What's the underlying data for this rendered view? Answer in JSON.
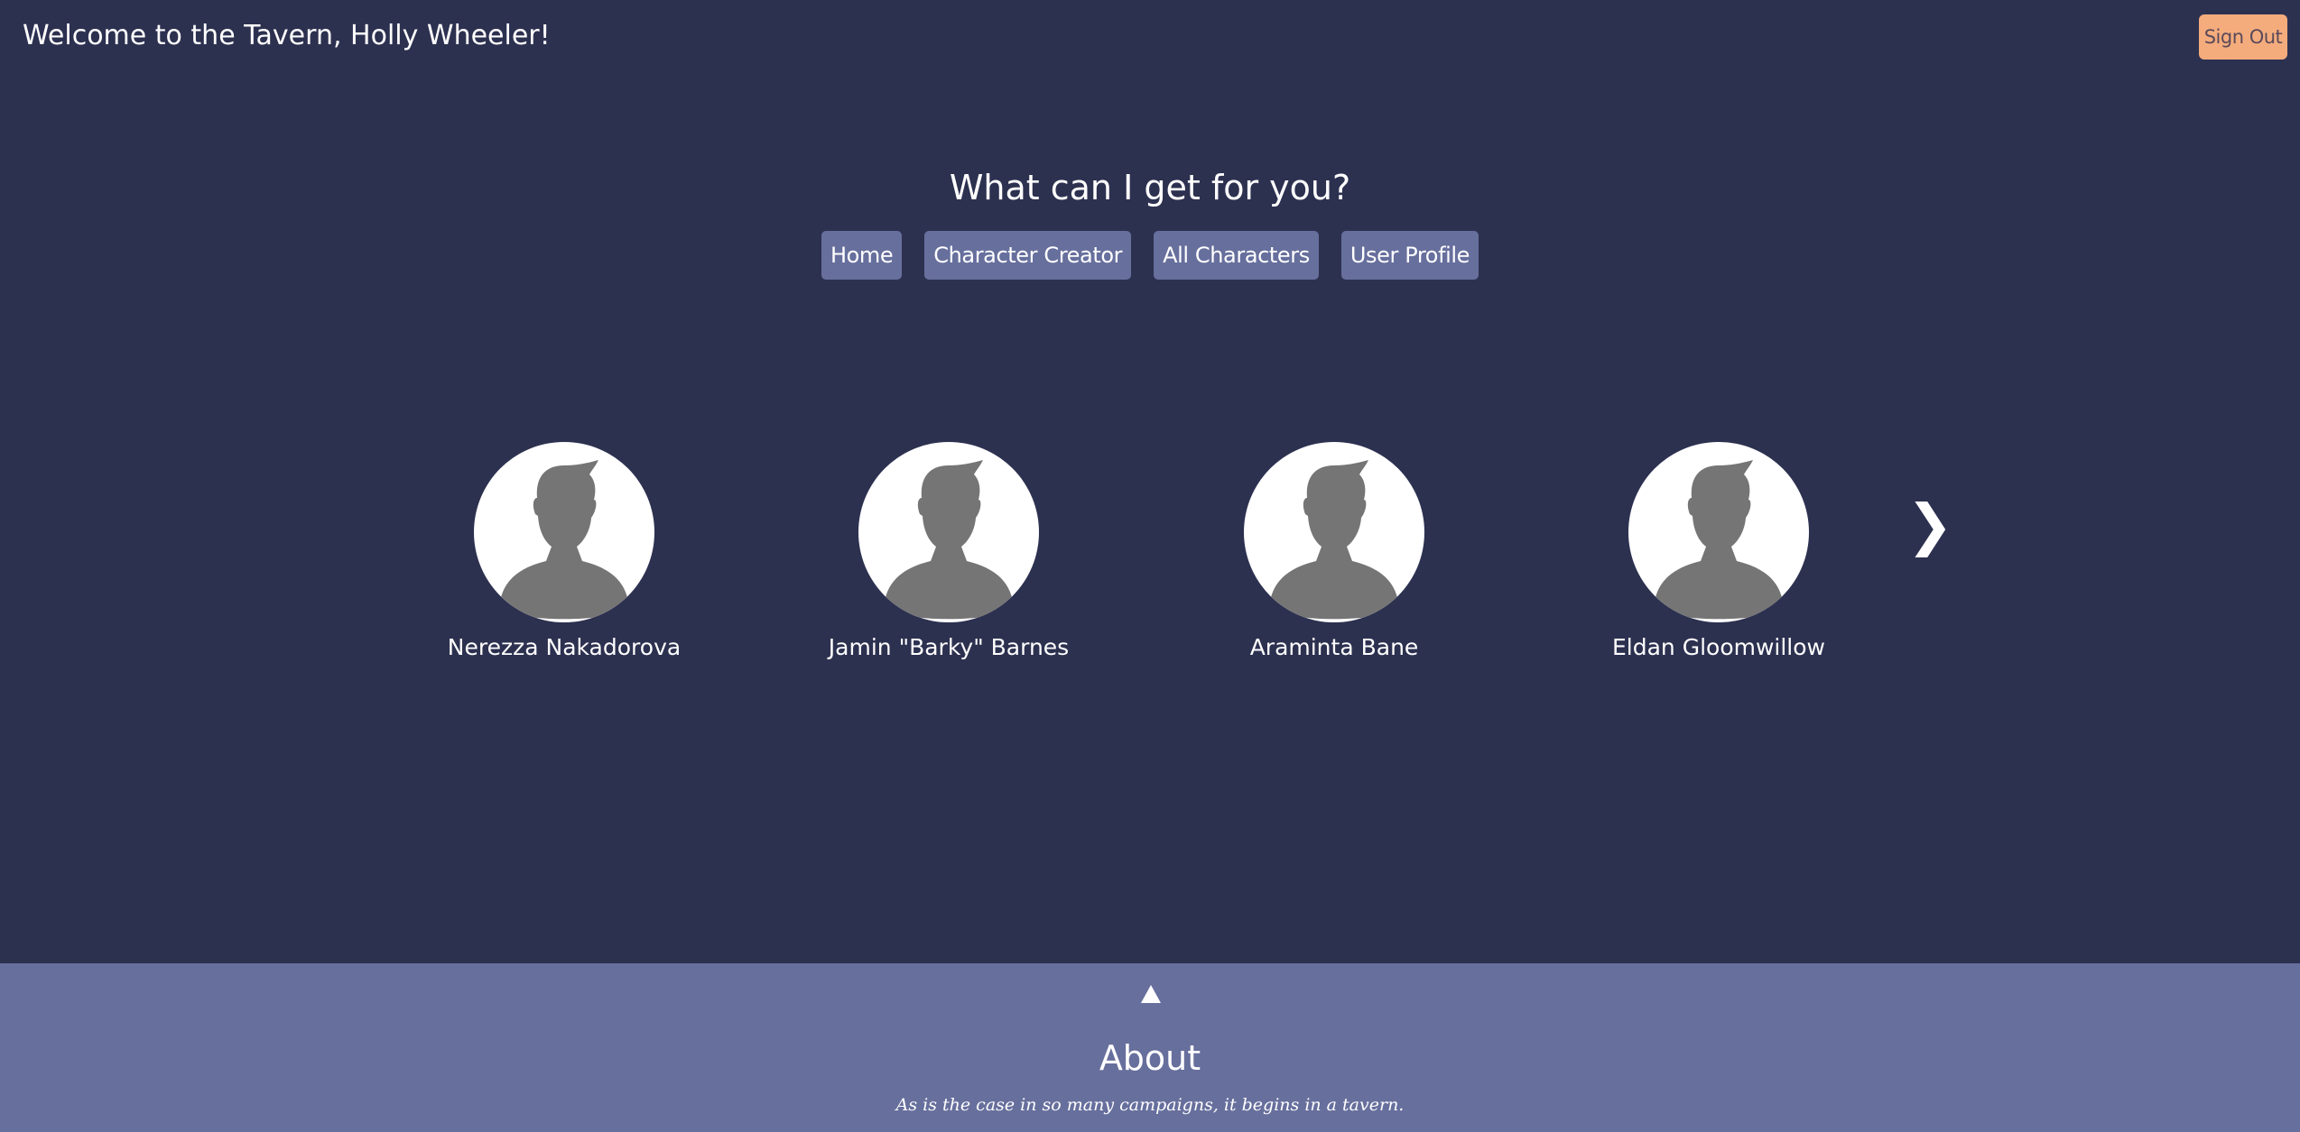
{
  "header": {
    "welcome": "Welcome to the Tavern, Holly Wheeler!",
    "sign_out_label": "Sign Out"
  },
  "main": {
    "heading": "What can I get for you?",
    "nav": [
      {
        "label": "Home"
      },
      {
        "label": "Character Creator"
      },
      {
        "label": "All Characters"
      },
      {
        "label": "User Profile"
      }
    ],
    "characters": [
      {
        "name": "Nerezza Nakadorova",
        "icon": "avatar-placeholder-icon"
      },
      {
        "name": "Jamin \"Barky\" Barnes",
        "icon": "avatar-placeholder-icon"
      },
      {
        "name": "Araminta Bane",
        "icon": "avatar-placeholder-icon"
      },
      {
        "name": "Eldan Gloomwillow",
        "icon": "avatar-placeholder-icon"
      }
    ],
    "next_icon": "chevron-right-icon",
    "next_glyph": "❯"
  },
  "footer": {
    "toggle_icon": "triangle-up-icon",
    "about_title": "About",
    "about_text": "As is the case in so many campaigns, it begins in a tavern."
  },
  "colors": {
    "background": "#2d3150",
    "accent": "#676f9d",
    "sign_out": "#f5ac7c",
    "avatar_silhouette": "#757575"
  }
}
